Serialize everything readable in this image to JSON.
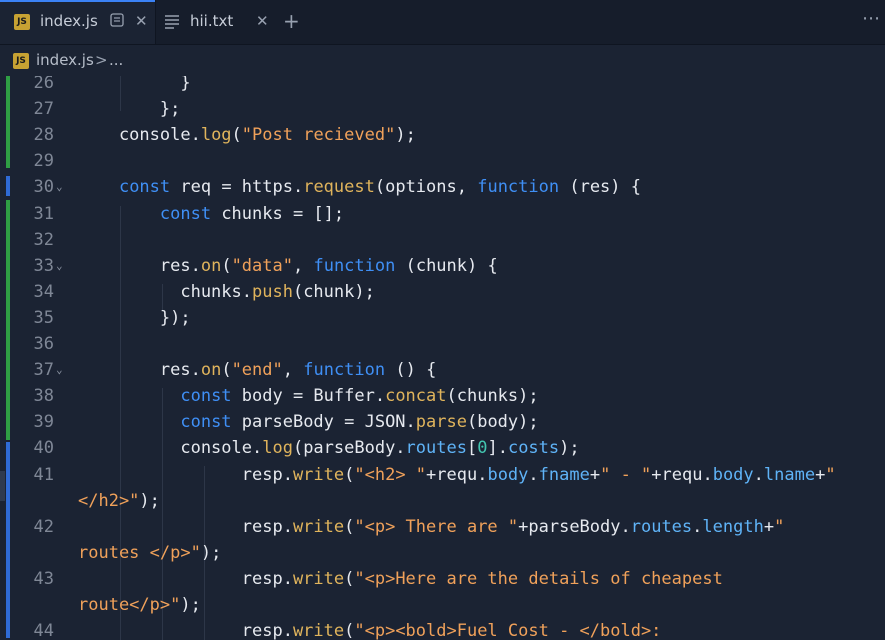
{
  "tabs": [
    {
      "label": "index.js",
      "icon": "js-file-icon",
      "badge": "JS",
      "active": true
    },
    {
      "label": "hii.txt",
      "icon": "text-file-icon",
      "active": false
    }
  ],
  "breadcrumb": {
    "file": "index.js",
    "badge": "JS",
    "separator": ">",
    "more": "..."
  },
  "lines": [
    {
      "n": "26",
      "fold": false,
      "wrap": false,
      "tokens": [
        [
          "txt",
          "          }"
        ]
      ]
    },
    {
      "n": "27",
      "fold": false,
      "wrap": false,
      "tokens": [
        [
          "txt",
          "        };"
        ]
      ]
    },
    {
      "n": "28",
      "fold": false,
      "wrap": false,
      "tokens": [
        [
          "txt",
          "    console."
        ],
        [
          "fn",
          "log"
        ],
        [
          "txt",
          "("
        ],
        [
          "str",
          "\"Post recieved\""
        ],
        [
          "txt",
          ");"
        ]
      ]
    },
    {
      "n": "29",
      "fold": false,
      "wrap": false,
      "tokens": []
    },
    {
      "n": "30",
      "fold": true,
      "wrap": false,
      "tokens": [
        [
          "txt",
          "    "
        ],
        [
          "kw",
          "const"
        ],
        [
          "txt",
          " req = https."
        ],
        [
          "fn",
          "request"
        ],
        [
          "txt",
          "(options, "
        ],
        [
          "kw",
          "function"
        ],
        [
          "txt",
          " (res) {"
        ]
      ]
    },
    {
      "n": "31",
      "fold": false,
      "wrap": false,
      "tokens": [
        [
          "txt",
          "        "
        ],
        [
          "kw",
          "const"
        ],
        [
          "txt",
          " chunks = [];"
        ]
      ]
    },
    {
      "n": "32",
      "fold": false,
      "wrap": false,
      "tokens": []
    },
    {
      "n": "33",
      "fold": true,
      "wrap": false,
      "tokens": [
        [
          "txt",
          "        res."
        ],
        [
          "fn",
          "on"
        ],
        [
          "txt",
          "("
        ],
        [
          "str",
          "\"data\""
        ],
        [
          "txt",
          ", "
        ],
        [
          "kw",
          "function"
        ],
        [
          "txt",
          " (chunk) {"
        ]
      ]
    },
    {
      "n": "34",
      "fold": false,
      "wrap": false,
      "tokens": [
        [
          "txt",
          "          chunks."
        ],
        [
          "fn",
          "push"
        ],
        [
          "txt",
          "(chunk);"
        ]
      ]
    },
    {
      "n": "35",
      "fold": false,
      "wrap": false,
      "tokens": [
        [
          "txt",
          "        });"
        ]
      ]
    },
    {
      "n": "36",
      "fold": false,
      "wrap": false,
      "tokens": []
    },
    {
      "n": "37",
      "fold": true,
      "wrap": false,
      "tokens": [
        [
          "txt",
          "        res."
        ],
        [
          "fn",
          "on"
        ],
        [
          "txt",
          "("
        ],
        [
          "str",
          "\"end\""
        ],
        [
          "txt",
          ", "
        ],
        [
          "kw",
          "function"
        ],
        [
          "txt",
          " () {"
        ]
      ]
    },
    {
      "n": "38",
      "fold": false,
      "wrap": false,
      "tokens": [
        [
          "txt",
          "          "
        ],
        [
          "kw",
          "const"
        ],
        [
          "txt",
          " body = Buffer."
        ],
        [
          "fn",
          "concat"
        ],
        [
          "txt",
          "(chunks);"
        ]
      ]
    },
    {
      "n": "39",
      "fold": false,
      "wrap": false,
      "tokens": [
        [
          "txt",
          "          "
        ],
        [
          "kw",
          "const"
        ],
        [
          "txt",
          " parseBody = JSON."
        ],
        [
          "fn",
          "parse"
        ],
        [
          "txt",
          "(body);"
        ]
      ]
    },
    {
      "n": "40",
      "fold": false,
      "wrap": false,
      "tokens": [
        [
          "txt",
          "          console."
        ],
        [
          "fn",
          "log"
        ],
        [
          "txt",
          "(parseBody."
        ],
        [
          "prop",
          "routes"
        ],
        [
          "txt",
          "["
        ],
        [
          "num",
          "0"
        ],
        [
          "txt",
          "]."
        ],
        [
          "prop",
          "costs"
        ],
        [
          "txt",
          ");"
        ]
      ]
    },
    {
      "n": "41",
      "fold": false,
      "wrap": false,
      "tokens": [
        [
          "txt",
          "                resp."
        ],
        [
          "fn",
          "write"
        ],
        [
          "txt",
          "("
        ],
        [
          "str",
          "\"<h2> \""
        ],
        [
          "txt",
          "+requ."
        ],
        [
          "prop",
          "body"
        ],
        [
          "txt",
          "."
        ],
        [
          "prop",
          "fname"
        ],
        [
          "txt",
          "+"
        ],
        [
          "str",
          "\" - \""
        ],
        [
          "txt",
          "+requ."
        ],
        [
          "prop",
          "body"
        ],
        [
          "txt",
          "."
        ],
        [
          "prop",
          "lname"
        ],
        [
          "txt",
          "+"
        ],
        [
          "str",
          "\""
        ]
      ]
    },
    {
      "n": "",
      "fold": false,
      "wrap": true,
      "tokens": [
        [
          "str",
          "</h2>\""
        ],
        [
          "txt",
          ");"
        ]
      ]
    },
    {
      "n": "42",
      "fold": false,
      "wrap": false,
      "tokens": [
        [
          "txt",
          "                resp."
        ],
        [
          "fn",
          "write"
        ],
        [
          "txt",
          "("
        ],
        [
          "str",
          "\"<p> There are \""
        ],
        [
          "txt",
          "+parseBody."
        ],
        [
          "prop",
          "routes"
        ],
        [
          "txt",
          "."
        ],
        [
          "prop",
          "length"
        ],
        [
          "txt",
          "+"
        ],
        [
          "str",
          "\""
        ]
      ]
    },
    {
      "n": "",
      "fold": false,
      "wrap": true,
      "tokens": [
        [
          "str",
          "routes </p>\""
        ],
        [
          "txt",
          ");"
        ]
      ]
    },
    {
      "n": "43",
      "fold": false,
      "wrap": false,
      "tokens": [
        [
          "txt",
          "                resp."
        ],
        [
          "fn",
          "write"
        ],
        [
          "txt",
          "("
        ],
        [
          "str",
          "\"<p>Here are the details of cheapest"
        ]
      ]
    },
    {
      "n": "",
      "fold": false,
      "wrap": true,
      "tokens": [
        [
          "str",
          "route</p>\""
        ],
        [
          "txt",
          ");"
        ]
      ]
    },
    {
      "n": "44",
      "fold": false,
      "wrap": false,
      "tokens": [
        [
          "txt",
          "                resp."
        ],
        [
          "fn",
          "write"
        ],
        [
          "txt",
          "("
        ],
        [
          "str",
          "\"<p><bold>Fuel Cost - </bold>:"
        ]
      ]
    }
  ]
}
